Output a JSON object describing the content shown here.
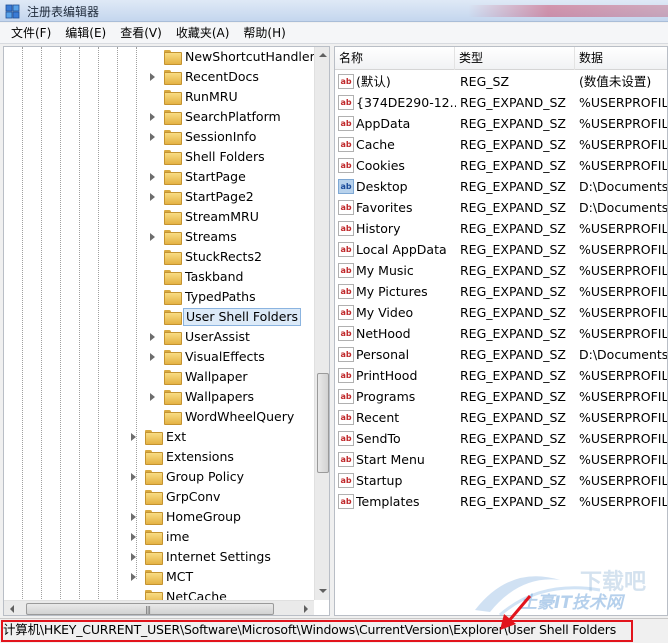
{
  "window": {
    "title": "注册表编辑器"
  },
  "menu": [
    "文件(F)",
    "编辑(E)",
    "查看(V)",
    "收藏夹(A)",
    "帮助(H)"
  ],
  "tree": {
    "items": [
      {
        "label": "NewShortcutHandlers",
        "level": 2,
        "expandable": false
      },
      {
        "label": "RecentDocs",
        "level": 2,
        "expandable": true
      },
      {
        "label": "RunMRU",
        "level": 2,
        "expandable": false
      },
      {
        "label": "SearchPlatform",
        "level": 2,
        "expandable": true
      },
      {
        "label": "SessionInfo",
        "level": 2,
        "expandable": true
      },
      {
        "label": "Shell Folders",
        "level": 2,
        "expandable": false
      },
      {
        "label": "StartPage",
        "level": 2,
        "expandable": true
      },
      {
        "label": "StartPage2",
        "level": 2,
        "expandable": true
      },
      {
        "label": "StreamMRU",
        "level": 2,
        "expandable": false
      },
      {
        "label": "Streams",
        "level": 2,
        "expandable": true
      },
      {
        "label": "StuckRects2",
        "level": 2,
        "expandable": false
      },
      {
        "label": "Taskband",
        "level": 2,
        "expandable": false
      },
      {
        "label": "TypedPaths",
        "level": 2,
        "expandable": false
      },
      {
        "label": "User Shell Folders",
        "level": 2,
        "expandable": false,
        "selected": true
      },
      {
        "label": "UserAssist",
        "level": 2,
        "expandable": true
      },
      {
        "label": "VisualEffects",
        "level": 2,
        "expandable": true
      },
      {
        "label": "Wallpaper",
        "level": 2,
        "expandable": false
      },
      {
        "label": "Wallpapers",
        "level": 2,
        "expandable": true
      },
      {
        "label": "WordWheelQuery",
        "level": 2,
        "expandable": false
      },
      {
        "label": "Ext",
        "level": 1,
        "expandable": true
      },
      {
        "label": "Extensions",
        "level": 1,
        "expandable": false
      },
      {
        "label": "Group Policy",
        "level": 1,
        "expandable": true
      },
      {
        "label": "GrpConv",
        "level": 1,
        "expandable": false
      },
      {
        "label": "HomeGroup",
        "level": 1,
        "expandable": true
      },
      {
        "label": "ime",
        "level": 1,
        "expandable": true
      },
      {
        "label": "Internet Settings",
        "level": 1,
        "expandable": true
      },
      {
        "label": "MCT",
        "level": 1,
        "expandable": true
      },
      {
        "label": "NetCache",
        "level": 1,
        "expandable": false
      }
    ],
    "hscroll_grip": "|||"
  },
  "list": {
    "columns": {
      "name": "名称",
      "type": "类型",
      "data": "数据"
    },
    "rows": [
      {
        "name": "(默认)",
        "type": "REG_SZ",
        "data": "(数值未设置)",
        "highlight": false
      },
      {
        "name": "{374DE290-12...",
        "type": "REG_EXPAND_SZ",
        "data": "%USERPROFILE",
        "highlight": false
      },
      {
        "name": "AppData",
        "type": "REG_EXPAND_SZ",
        "data": "%USERPROFILE",
        "highlight": false
      },
      {
        "name": "Cache",
        "type": "REG_EXPAND_SZ",
        "data": "%USERPROFILE",
        "highlight": false
      },
      {
        "name": "Cookies",
        "type": "REG_EXPAND_SZ",
        "data": "%USERPROFILE",
        "highlight": false
      },
      {
        "name": "Desktop",
        "type": "REG_EXPAND_SZ",
        "data": "D:\\Documents\\",
        "highlight": true
      },
      {
        "name": "Favorites",
        "type": "REG_EXPAND_SZ",
        "data": "D:\\Documents\\",
        "highlight": false
      },
      {
        "name": "History",
        "type": "REG_EXPAND_SZ",
        "data": "%USERPROFILE",
        "highlight": false
      },
      {
        "name": "Local AppData",
        "type": "REG_EXPAND_SZ",
        "data": "%USERPROFILE",
        "highlight": false
      },
      {
        "name": "My Music",
        "type": "REG_EXPAND_SZ",
        "data": "%USERPROFILE",
        "highlight": false
      },
      {
        "name": "My Pictures",
        "type": "REG_EXPAND_SZ",
        "data": "%USERPROFILE",
        "highlight": false
      },
      {
        "name": "My Video",
        "type": "REG_EXPAND_SZ",
        "data": "%USERPROFILE",
        "highlight": false
      },
      {
        "name": "NetHood",
        "type": "REG_EXPAND_SZ",
        "data": "%USERPROFILE",
        "highlight": false
      },
      {
        "name": "Personal",
        "type": "REG_EXPAND_SZ",
        "data": "D:\\Documents",
        "highlight": false
      },
      {
        "name": "PrintHood",
        "type": "REG_EXPAND_SZ",
        "data": "%USERPROFILE",
        "highlight": false
      },
      {
        "name": "Programs",
        "type": "REG_EXPAND_SZ",
        "data": "%USERPROFILE",
        "highlight": false
      },
      {
        "name": "Recent",
        "type": "REG_EXPAND_SZ",
        "data": "%USERPROFILE",
        "highlight": false
      },
      {
        "name": "SendTo",
        "type": "REG_EXPAND_SZ",
        "data": "%USERPROFILE",
        "highlight": false
      },
      {
        "name": "Start Menu",
        "type": "REG_EXPAND_SZ",
        "data": "%USERPROFILE",
        "highlight": false
      },
      {
        "name": "Startup",
        "type": "REG_EXPAND_SZ",
        "data": "%USERPROFILE",
        "highlight": false
      },
      {
        "name": "Templates",
        "type": "REG_EXPAND_SZ",
        "data": "%USERPROFILE",
        "highlight": false
      }
    ]
  },
  "statusbar": {
    "path": "计算机\\HKEY_CURRENT_USER\\Software\\Microsoft\\Windows\\CurrentVersion\\Explorer\\User Shell Folders"
  },
  "value_icon_glyph": "ab",
  "watermark": {
    "line1": "下载吧",
    "line2": "土豪IT技术网"
  },
  "colors": {
    "status_highlight": "#e2141c",
    "selection": "#dceaf8",
    "folder": "#f1c65c"
  }
}
